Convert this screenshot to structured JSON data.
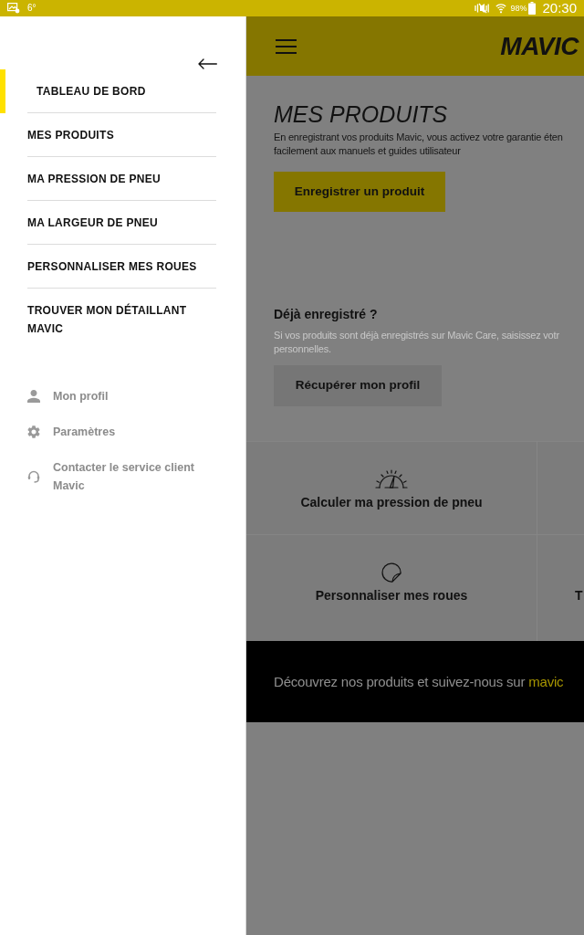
{
  "status_bar": {
    "temperature": "6°",
    "battery": "98%",
    "time": "20:30"
  },
  "drawer": {
    "items": [
      {
        "label": "TABLEAU DE BORD",
        "selected": true
      },
      {
        "label": "MES PRODUITS",
        "selected": false
      },
      {
        "label": "MA PRESSION DE PNEU",
        "selected": false
      },
      {
        "label": "MA LARGEUR DE PNEU",
        "selected": false
      },
      {
        "label": "PERSONNALISER MES ROUES",
        "selected": false
      },
      {
        "label": "TROUVER MON DÉTAILLANT MAVIC",
        "selected": false
      }
    ],
    "secondary_items": [
      {
        "kind": "profile",
        "label": "Mon profil"
      },
      {
        "kind": "settings",
        "label": "Paramètres"
      },
      {
        "kind": "support",
        "label": "Contacter le service client Mavic"
      }
    ]
  },
  "header": {
    "logo": "MAVIC"
  },
  "products": {
    "title": "MES PRODUITS",
    "description_lines": [
      "En enregistrant vos produits Mavic, vous activez votre garantie éten",
      "facilement aux manuels et guides utilisateur"
    ],
    "button": "Enregistrer un produit"
  },
  "registered": {
    "title": "Déjà enregistré ?",
    "description_lines": [
      "Si vos produits sont déjà enregistrés sur Mavic Care, saisissez votr",
      "personnelles."
    ],
    "button": "Récupérer mon profil"
  },
  "tiles": [
    {
      "kind": "gauge",
      "label": "Calculer ma pression de pneu"
    },
    {
      "kind": "blank"
    },
    {
      "kind": "sticker",
      "label": "Personnaliser mes roues"
    },
    {
      "kind": "cut",
      "label": "T"
    }
  ],
  "footer": {
    "text": "Découvrez nos produits et suivez-nous sur",
    "link": "mavic"
  }
}
